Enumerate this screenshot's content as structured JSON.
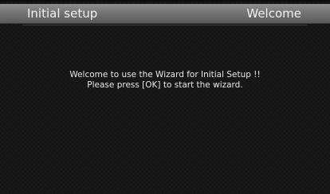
{
  "header": {
    "title": "Initial setup",
    "section": "Welcome"
  },
  "message": {
    "line1": "Welcome to use the Wizard for Initial Setup !!",
    "line2": "Please press [OK] to start the wizard."
  }
}
